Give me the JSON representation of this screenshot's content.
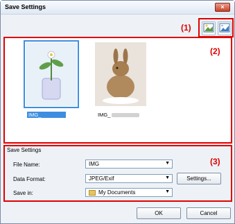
{
  "window": {
    "title": "Save Settings",
    "close_glyph": "×"
  },
  "callouts": {
    "c1": "(1)",
    "c2": "(2)",
    "c3": "(3)"
  },
  "toolbar": {
    "buttons": [
      {
        "icon": "image-view-icon"
      },
      {
        "icon": "image-list-icon"
      }
    ]
  },
  "thumbnails": [
    {
      "label": "IMG_",
      "selected": true
    },
    {
      "label": "IMG_",
      "selected": false
    }
  ],
  "save_settings": {
    "section_title": "Save Settings",
    "file_name_label": "File Name:",
    "file_name_value": "IMG",
    "data_format_label": "Data Format:",
    "data_format_value": "JPEG/Exif",
    "settings_button": "Settings...",
    "save_in_label": "Save in:",
    "save_in_value": "My Documents",
    "dropdown_glyph": "▼"
  },
  "footer": {
    "ok": "OK",
    "cancel": "Cancel"
  }
}
